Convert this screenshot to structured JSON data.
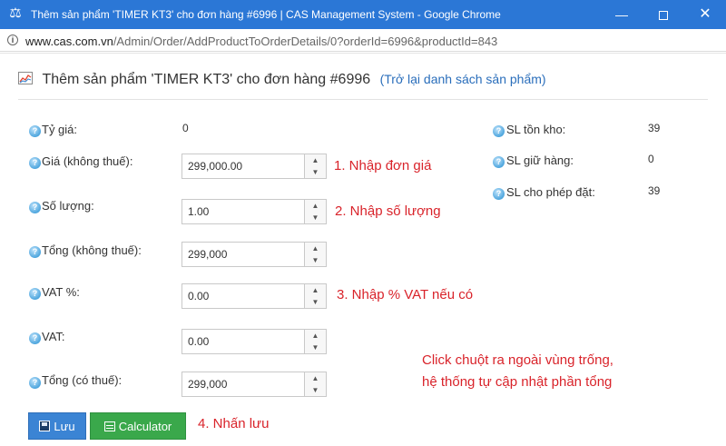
{
  "window": {
    "title": "Thêm sản phẩm 'TIMER KT3' cho đơn hàng #6996 | CAS Management System - Google Chrome",
    "minimize_label": "—",
    "close_label": "✕"
  },
  "address": {
    "host": "www.cas.com.vn",
    "path": "/Admin/Order/AddProductToOrderDetails/0?orderId=6996&productId=843"
  },
  "page": {
    "title": "Thêm sản phẩm 'TIMER KT3' cho đơn hàng #6996",
    "back_link": "(Trở lại danh sách sản phẩm)"
  },
  "form": {
    "exchange_rate": {
      "label": "Tỷ giá:",
      "value": "0"
    },
    "price": {
      "label": "Giá (không thuế):",
      "value": "299,000.00"
    },
    "quantity": {
      "label": "Số lượng:",
      "value": "1.00"
    },
    "total_excl": {
      "label": "Tổng (không thuế):",
      "value": "299,000"
    },
    "vat_percent": {
      "label": "VAT %:",
      "value": "0.00"
    },
    "vat": {
      "label": "VAT:",
      "value": "0.00"
    },
    "total_incl": {
      "label": "Tổng (có thuế):",
      "value": "299,000"
    }
  },
  "stock": {
    "in_stock": {
      "label": "SL tồn kho:",
      "value": "39"
    },
    "reserved": {
      "label": "SL giữ hàng:",
      "value": "0"
    },
    "allowed": {
      "label": "SL cho phép đặt:",
      "value": "39"
    }
  },
  "annotations": {
    "step1": "1. Nhập đơn giá",
    "step2": "2. Nhập số lượng",
    "step3": "3. Nhập % VAT nếu có",
    "step4": "4. Nhấn lưu",
    "note_line1": "Click chuột ra ngoài vùng trống,",
    "note_line2": "hệ thống tự cập nhật phần tổng"
  },
  "buttons": {
    "save": "Lưu",
    "calculator": "Calculator"
  },
  "icons": {
    "help": "question-circle-icon",
    "spin_up": "▲",
    "spin_down": "▼"
  },
  "colors": {
    "titlebar": "#2b77d6",
    "annotation": "#d9232a",
    "save_button": "#3b84d4",
    "calc_button": "#3aa84b",
    "link": "#2a6ebb"
  }
}
